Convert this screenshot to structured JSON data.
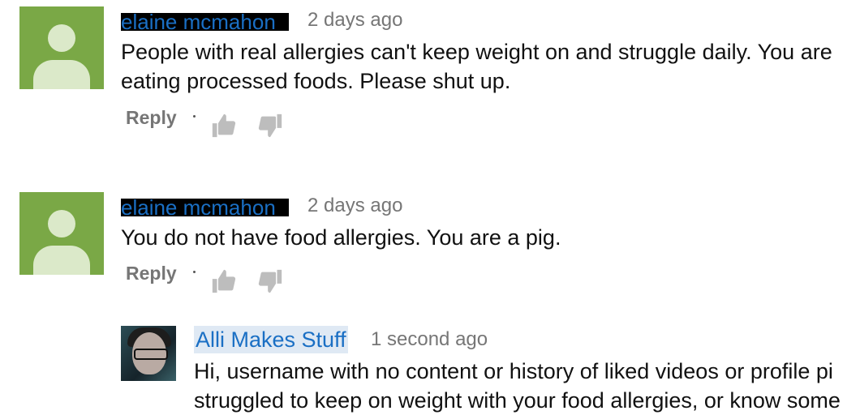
{
  "comments": [
    {
      "author": "elaine mcmahon",
      "time": "2 days ago",
      "text": "People with real allergies can't keep weight on and struggle daily. You are\neating processed foods. Please shut up.",
      "reply_label": "Reply"
    },
    {
      "author": "elaine mcmahon",
      "time": "2 days ago",
      "text": "You do not have food allergies. You are a pig.",
      "reply_label": "Reply"
    }
  ],
  "reply": {
    "author": "Alli Makes Stuff",
    "time": "1 second ago",
    "line1": "Hi,  username with no content or history of liked videos or profile pi",
    "line2": "struggled to keep on weight with your food allergies, or know some"
  },
  "colors": {
    "avatar_green": "#7aa846",
    "link_blue": "#1a6fc4",
    "meta_gray": "#767676"
  },
  "icons": [
    "user-default-icon",
    "thumbs-up-icon",
    "thumbs-down-icon"
  ]
}
